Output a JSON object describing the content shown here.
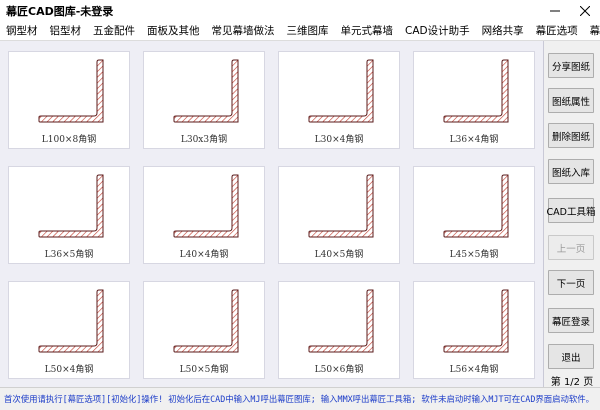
{
  "window": {
    "title": "幕匠CAD图库-未登录"
  },
  "menu": [
    "钢型材",
    "铝型材",
    "五金配件",
    "面板及其他",
    "常见幕墙做法",
    "三维图库",
    "单元式幕墙",
    "CAD设计助手",
    "网络共享",
    "幕匠选项",
    "幕匠+"
  ],
  "items": [
    {
      "label": "L100×8角钢"
    },
    {
      "label": "L30x3角钢"
    },
    {
      "label": "L30×4角钢"
    },
    {
      "label": "L36×4角钢"
    },
    {
      "label": "L36×5角钢"
    },
    {
      "label": "L40×4角钢"
    },
    {
      "label": "L40×5角钢"
    },
    {
      "label": "L45×5角钢"
    },
    {
      "label": "L50×4角钢"
    },
    {
      "label": "L50×5角钢"
    },
    {
      "label": "L50×6角钢"
    },
    {
      "label": "L56×4角钢"
    }
  ],
  "sidebar": {
    "buttons": [
      {
        "label": "分享图纸",
        "enabled": true
      },
      {
        "label": "图纸属性",
        "enabled": true
      },
      {
        "label": "删除图纸",
        "enabled": true
      },
      {
        "label": "图纸入库",
        "enabled": true
      },
      {
        "label": "CAD工具箱",
        "enabled": true
      },
      {
        "label": "上一页",
        "enabled": false
      },
      {
        "label": "下一页",
        "enabled": true
      },
      {
        "label": "幕匠登录",
        "enabled": true
      },
      {
        "label": "退出",
        "enabled": true
      }
    ],
    "page_indicator": "第 1/2 页"
  },
  "status": {
    "message": "首次使用请执行[幕匠选项][初始化]操作! 初始化后在CAD中输入MJ呼出幕匠图库; 输入MMX呼出幕匠工具箱; 软件未启动时输入MJT可在CAD界面启动软件。"
  },
  "colors": {
    "hatch": "#c0392b",
    "outline": "#5a1a1a",
    "status_text": "#1c3cc8",
    "content_bg": "#eeeef5"
  },
  "icons": {
    "minimize": "minimize-icon",
    "close": "close-icon"
  }
}
